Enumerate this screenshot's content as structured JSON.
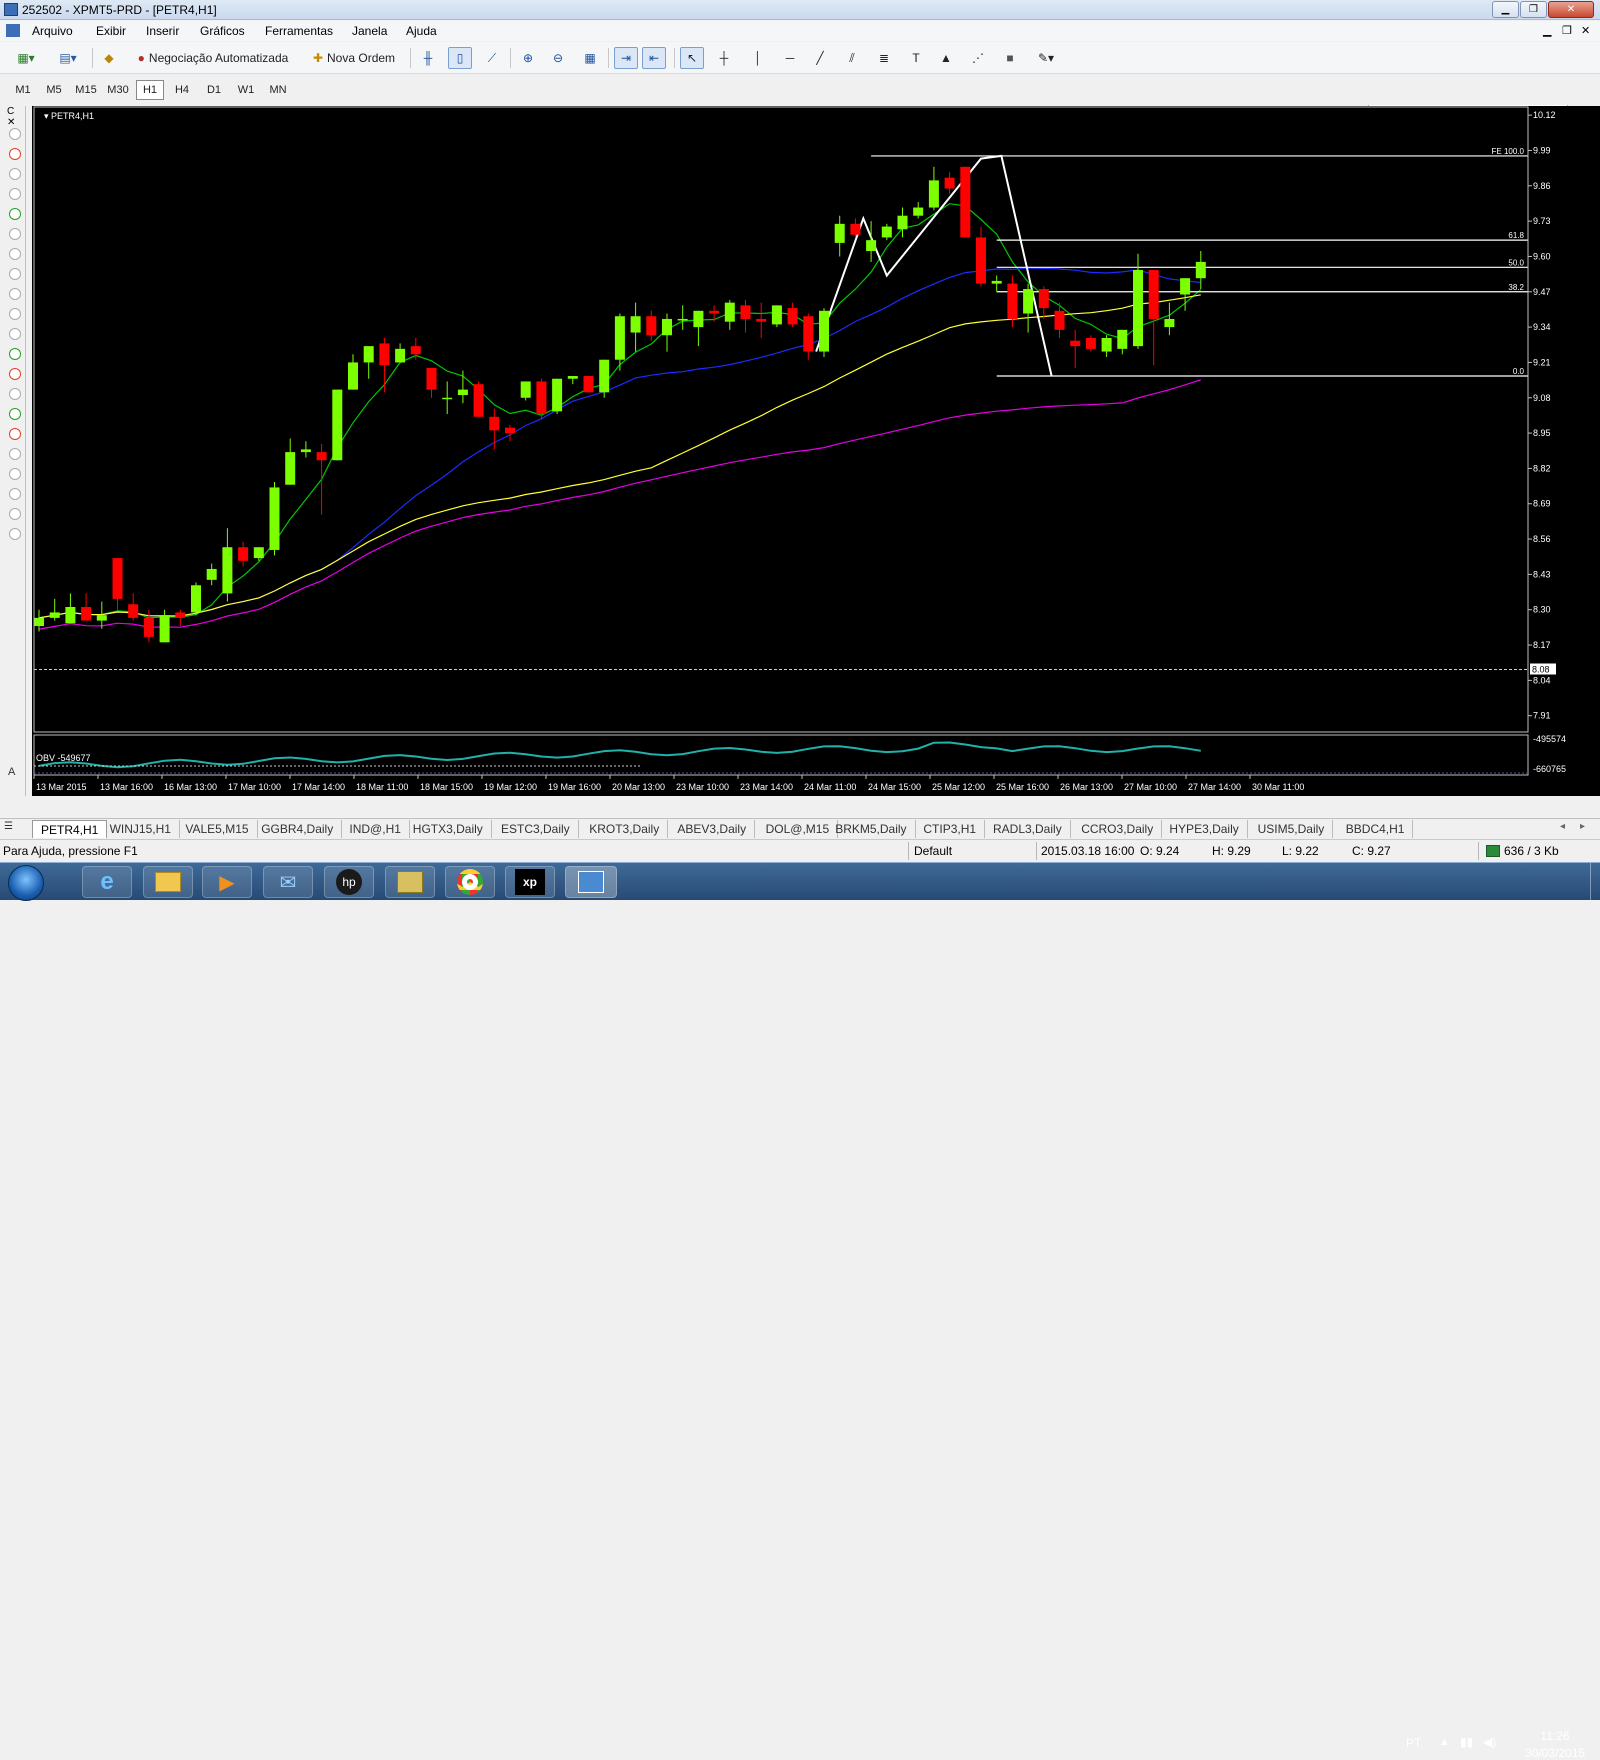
{
  "window": {
    "title": "252502 - XPMT5-PRD - [PETR4,H1]",
    "controls": [
      "minimize",
      "restore",
      "close"
    ]
  },
  "menu": {
    "items": [
      "Arquivo",
      "Exibir",
      "Inserir",
      "Gráficos",
      "Ferramentas",
      "Janela",
      "Ajuda"
    ]
  },
  "toolbar": {
    "auto_trading_label": "Negociação Automatizada",
    "new_order_label": "Nova Ordem",
    "search_placeholder": ""
  },
  "timeframes": {
    "items": [
      "M1",
      "M5",
      "M15",
      "M30",
      "H1",
      "H4",
      "D1",
      "W1",
      "MN"
    ],
    "selected": "H1"
  },
  "chart": {
    "title": "PETR4,H1",
    "symbol": "PETR4",
    "timeframe": "H1",
    "price_axis": [
      "10.12",
      "9.99",
      "9.86",
      "9.73",
      "9.60",
      "9.47",
      "9.34",
      "9.21",
      "9.08",
      "8.95",
      "8.82",
      "8.69",
      "8.56",
      "8.43",
      "8.30",
      "8.17",
      "8.04",
      "7.91"
    ],
    "current_price": "8.08",
    "time_axis": [
      "13 Mar 2015",
      "13 Mar 16:00",
      "16 Mar 13:00",
      "17 Mar 10:00",
      "17 Mar 14:00",
      "18 Mar 11:00",
      "18 Mar 15:00",
      "19 Mar 12:00",
      "19 Mar 16:00",
      "20 Mar 13:00",
      "23 Mar 10:00",
      "23 Mar 14:00",
      "24 Mar 11:00",
      "24 Mar 15:00",
      "25 Mar 12:00",
      "25 Mar 16:00",
      "26 Mar 13:00",
      "27 Mar 10:00",
      "27 Mar 14:00",
      "30 Mar 11:00"
    ],
    "fibo_labels": [
      "FE 100.0",
      "61.8",
      "50.0",
      "38.2",
      "0.0"
    ],
    "obv_title": "OBV -549677",
    "obv_axis": [
      "-495574",
      "-660765"
    ],
    "colors": {
      "bull": "#7cff00",
      "bear": "#ff0000",
      "ma_fast": "#00c800",
      "ma_mid": "#1c2cff",
      "ma_slow": "#ffff33",
      "ma_long": "#e600e6",
      "obv": "#20b2aa"
    }
  },
  "chart_data": {
    "type": "candlestick",
    "title": "PETR4,H1",
    "ylim": [
      7.85,
      10.15
    ],
    "candles": [
      {
        "o": 8.24,
        "h": 8.3,
        "l": 8.22,
        "c": 8.27
      },
      {
        "o": 8.27,
        "h": 8.34,
        "l": 8.26,
        "c": 8.29
      },
      {
        "o": 8.25,
        "h": 8.36,
        "l": 8.25,
        "c": 8.31
      },
      {
        "o": 8.31,
        "h": 8.36,
        "l": 8.28,
        "c": 8.26
      },
      {
        "o": 8.26,
        "h": 8.33,
        "l": 8.23,
        "c": 8.28
      },
      {
        "o": 8.49,
        "h": 8.49,
        "l": 8.3,
        "c": 8.34
      },
      {
        "o": 8.32,
        "h": 8.36,
        "l": 8.26,
        "c": 8.27
      },
      {
        "o": 8.27,
        "h": 8.3,
        "l": 8.18,
        "c": 8.2
      },
      {
        "o": 8.18,
        "h": 8.3,
        "l": 8.18,
        "c": 8.28
      },
      {
        "o": 8.29,
        "h": 8.3,
        "l": 8.24,
        "c": 8.27
      },
      {
        "o": 8.29,
        "h": 8.4,
        "l": 8.28,
        "c": 8.39
      },
      {
        "o": 8.41,
        "h": 8.47,
        "l": 8.39,
        "c": 8.45
      },
      {
        "o": 8.36,
        "h": 8.6,
        "l": 8.33,
        "c": 8.53
      },
      {
        "o": 8.53,
        "h": 8.55,
        "l": 8.46,
        "c": 8.48
      },
      {
        "o": 8.49,
        "h": 8.53,
        "l": 8.48,
        "c": 8.53
      },
      {
        "o": 8.52,
        "h": 8.77,
        "l": 8.5,
        "c": 8.75
      },
      {
        "o": 8.76,
        "h": 8.93,
        "l": 8.76,
        "c": 8.88
      },
      {
        "o": 8.88,
        "h": 8.92,
        "l": 8.86,
        "c": 8.89
      },
      {
        "o": 8.88,
        "h": 8.91,
        "l": 8.65,
        "c": 8.85
      },
      {
        "o": 8.85,
        "h": 9.11,
        "l": 8.85,
        "c": 9.11
      },
      {
        "o": 9.11,
        "h": 9.24,
        "l": 9.11,
        "c": 9.21
      },
      {
        "o": 9.21,
        "h": 9.27,
        "l": 9.15,
        "c": 9.27
      },
      {
        "o": 9.28,
        "h": 9.3,
        "l": 9.1,
        "c": 9.2
      },
      {
        "o": 9.21,
        "h": 9.28,
        "l": 9.21,
        "c": 9.26
      },
      {
        "o": 9.27,
        "h": 9.3,
        "l": 9.22,
        "c": 9.24
      },
      {
        "o": 9.19,
        "h": 9.19,
        "l": 9.08,
        "c": 9.11
      },
      {
        "o": 9.08,
        "h": 9.14,
        "l": 9.02,
        "c": 9.08
      },
      {
        "o": 9.09,
        "h": 9.18,
        "l": 9.06,
        "c": 9.11
      },
      {
        "o": 9.13,
        "h": 9.14,
        "l": 9.02,
        "c": 9.01
      },
      {
        "o": 9.01,
        "h": 9.04,
        "l": 8.89,
        "c": 8.96
      },
      {
        "o": 8.97,
        "h": 8.98,
        "l": 8.92,
        "c": 8.95
      },
      {
        "o": 9.08,
        "h": 9.14,
        "l": 9.07,
        "c": 9.14
      },
      {
        "o": 9.14,
        "h": 9.15,
        "l": 9.0,
        "c": 9.02
      },
      {
        "o": 9.03,
        "h": 9.15,
        "l": 9.02,
        "c": 9.15
      },
      {
        "o": 9.15,
        "h": 9.16,
        "l": 9.13,
        "c": 9.16
      },
      {
        "o": 9.16,
        "h": 9.16,
        "l": 9.1,
        "c": 9.1
      },
      {
        "o": 9.1,
        "h": 9.22,
        "l": 9.08,
        "c": 9.22
      },
      {
        "o": 9.22,
        "h": 9.39,
        "l": 9.18,
        "c": 9.38
      },
      {
        "o": 9.32,
        "h": 9.43,
        "l": 9.25,
        "c": 9.38
      },
      {
        "o": 9.38,
        "h": 9.4,
        "l": 9.29,
        "c": 9.31
      },
      {
        "o": 9.31,
        "h": 9.39,
        "l": 9.25,
        "c": 9.37
      },
      {
        "o": 9.37,
        "h": 9.42,
        "l": 9.33,
        "c": 9.37
      },
      {
        "o": 9.34,
        "h": 9.4,
        "l": 9.27,
        "c": 9.4
      },
      {
        "o": 9.4,
        "h": 9.42,
        "l": 9.36,
        "c": 9.39
      },
      {
        "o": 9.36,
        "h": 9.44,
        "l": 9.33,
        "c": 9.43
      },
      {
        "o": 9.42,
        "h": 9.44,
        "l": 9.32,
        "c": 9.37
      },
      {
        "o": 9.37,
        "h": 9.43,
        "l": 9.3,
        "c": 9.36
      },
      {
        "o": 9.35,
        "h": 9.42,
        "l": 9.34,
        "c": 9.42
      },
      {
        "o": 9.41,
        "h": 9.43,
        "l": 9.34,
        "c": 9.35
      },
      {
        "o": 9.38,
        "h": 9.39,
        "l": 9.22,
        "c": 9.25
      },
      {
        "o": 9.25,
        "h": 9.41,
        "l": 9.23,
        "c": 9.4
      },
      {
        "o": 9.65,
        "h": 9.75,
        "l": 9.6,
        "c": 9.72
      },
      {
        "o": 9.72,
        "h": 9.74,
        "l": 9.67,
        "c": 9.68
      },
      {
        "o": 9.62,
        "h": 9.73,
        "l": 9.58,
        "c": 9.66
      },
      {
        "o": 9.67,
        "h": 9.72,
        "l": 9.66,
        "c": 9.71
      },
      {
        "o": 9.7,
        "h": 9.78,
        "l": 9.67,
        "c": 9.75
      },
      {
        "o": 9.75,
        "h": 9.8,
        "l": 9.74,
        "c": 9.78
      },
      {
        "o": 9.78,
        "h": 9.93,
        "l": 9.77,
        "c": 9.88
      },
      {
        "o": 9.89,
        "h": 9.91,
        "l": 9.83,
        "c": 9.85
      },
      {
        "o": 9.93,
        "h": 9.93,
        "l": 9.76,
        "c": 9.67
      },
      {
        "o": 9.67,
        "h": 9.71,
        "l": 9.49,
        "c": 9.5
      },
      {
        "o": 9.5,
        "h": 9.53,
        "l": 9.47,
        "c": 9.51
      },
      {
        "o": 9.5,
        "h": 9.53,
        "l": 9.34,
        "c": 9.37
      },
      {
        "o": 9.39,
        "h": 9.5,
        "l": 9.32,
        "c": 9.48
      },
      {
        "o": 9.48,
        "h": 9.49,
        "l": 9.37,
        "c": 9.41
      },
      {
        "o": 9.4,
        "h": 9.43,
        "l": 9.3,
        "c": 9.33
      },
      {
        "o": 9.29,
        "h": 9.33,
        "l": 9.19,
        "c": 9.27
      },
      {
        "o": 9.3,
        "h": 9.31,
        "l": 9.25,
        "c": 9.26
      },
      {
        "o": 9.25,
        "h": 9.31,
        "l": 9.23,
        "c": 9.3
      },
      {
        "o": 9.26,
        "h": 9.33,
        "l": 9.24,
        "c": 9.33
      },
      {
        "o": 9.27,
        "h": 9.61,
        "l": 9.26,
        "c": 9.55
      },
      {
        "o": 9.55,
        "h": 9.55,
        "l": 9.2,
        "c": 9.37
      },
      {
        "o": 9.34,
        "h": 9.43,
        "l": 9.31,
        "c": 9.37
      },
      {
        "o": 9.46,
        "h": 9.52,
        "l": 9.4,
        "c": 9.52
      },
      {
        "o": 9.52,
        "h": 9.62,
        "l": 9.48,
        "c": 9.58
      }
    ],
    "fibonacci": {
      "levels": [
        "FE 100.0",
        "61.8",
        "50.0",
        "38.2",
        "0.0"
      ],
      "prices": [
        9.97,
        9.66,
        9.56,
        9.47,
        9.16
      ]
    },
    "obv": {
      "label": "OBV -549677",
      "ylim": [
        -660765,
        -495574
      ]
    }
  },
  "tabs": {
    "items": [
      "PETR4,H1",
      "WINJ15,H1",
      "VALE5,M15",
      "GGBR4,Daily",
      "IND@,H1",
      "HGTX3,Daily",
      "ESTC3,Daily",
      "KROT3,Daily",
      "ABEV3,Daily",
      "DOL@,M15",
      "BRKM5,Daily",
      "CTIP3,H1",
      "RADL3,Daily",
      "CCRO3,Daily",
      "HYPE3,Daily",
      "USIM5,Daily",
      "BBDC4,H1"
    ],
    "active": "PETR4,H1"
  },
  "status": {
    "help": "Para Ajuda, pressione F1",
    "profile": "Default",
    "datetime": "2015.03.18 16:00",
    "open": "O: 9.24",
    "high": "H: 9.29",
    "low": "L: 9.22",
    "close": "C: 9.27",
    "traffic": "636 / 3 Kb"
  },
  "taskbar": {
    "lang": "PT",
    "time": "11:26",
    "date": "30/03/2015"
  }
}
